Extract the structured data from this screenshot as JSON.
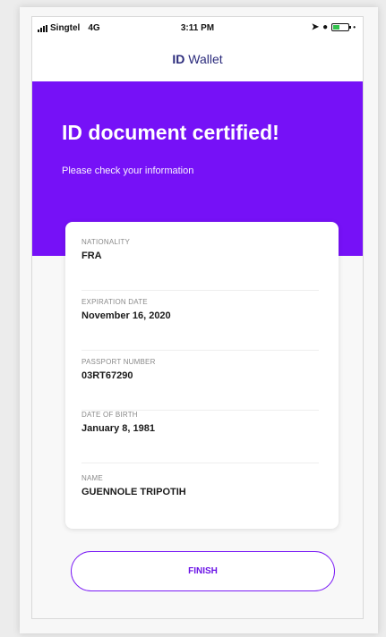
{
  "status_bar": {
    "carrier": "Singtel",
    "network": "4G",
    "time": "3:11 PM",
    "battery_level": 0.45,
    "battery_color": "#32c24d"
  },
  "nav": {
    "brand": "ID",
    "title": "Wallet"
  },
  "hero": {
    "title": "ID document certified!",
    "subtitle": "Please check your information",
    "background": "#7611f7"
  },
  "fields": [
    {
      "label": "NATIONALITY",
      "value": "FRA"
    },
    {
      "label": "EXPIRATION DATE",
      "value": "November 16, 2020"
    },
    {
      "label": "PASSPORT NUMBER",
      "value": "03RT67290"
    },
    {
      "label": "DATE OF BIRTH",
      "value": "January 8, 1981"
    },
    {
      "label": "NAME",
      "value": "GUENNOLE TRIPOTIH"
    }
  ],
  "actions": {
    "finish_label": "FINISH",
    "accent": "#7a1af5"
  }
}
